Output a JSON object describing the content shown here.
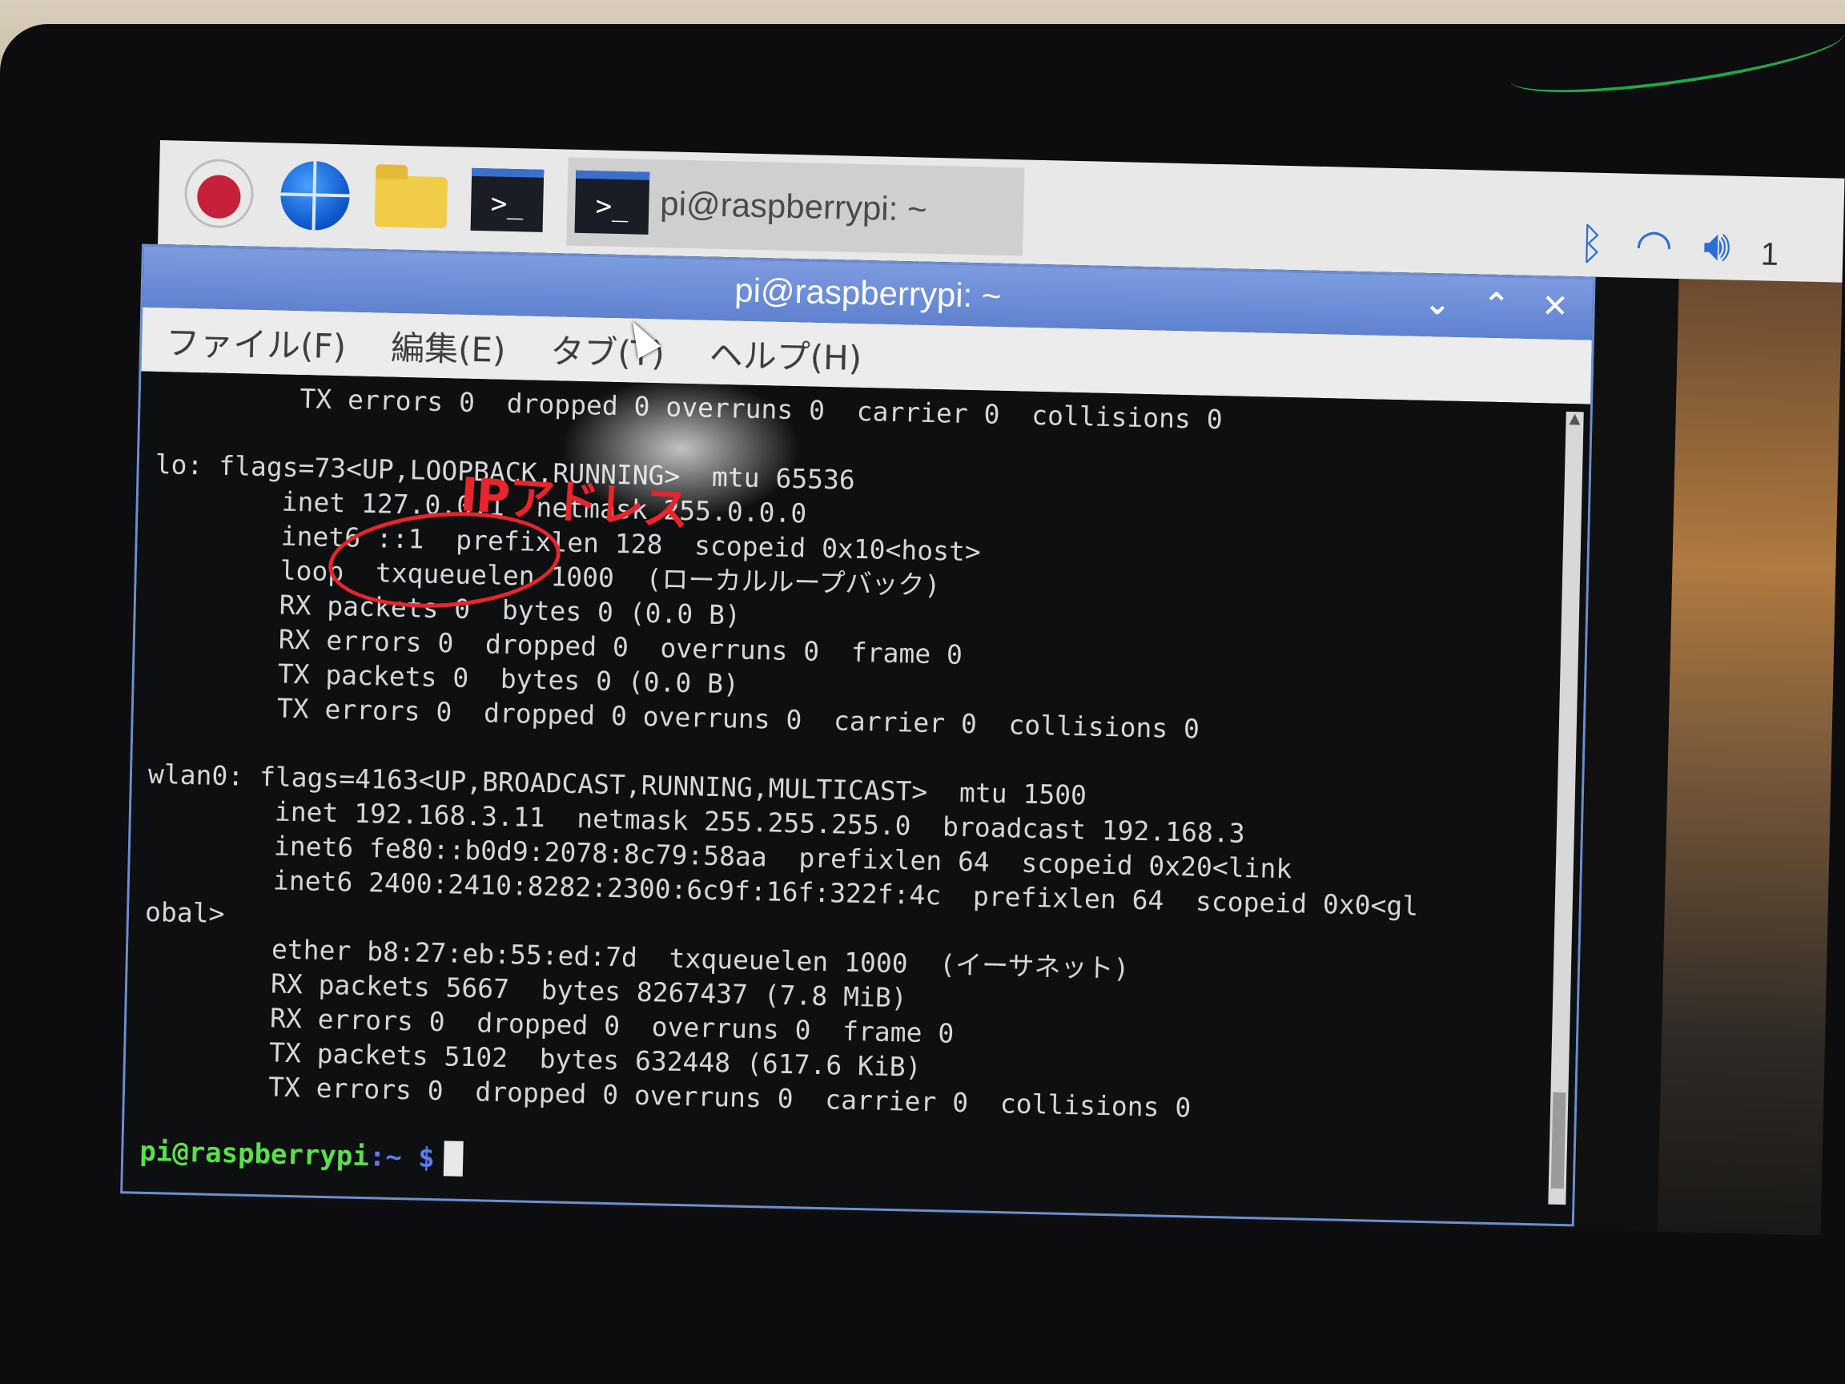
{
  "taskbar": {
    "task_title": "pi@raspberrypi: ~",
    "term_glyph": ">_",
    "clock": "1"
  },
  "window": {
    "title": "pi@raspberrypi: ~",
    "buttons": [
      "⌄",
      "⌃",
      "✕"
    ],
    "menu": [
      "ファイル(F)",
      "編集(E)",
      "タブ(T)",
      "ヘルプ(H)"
    ]
  },
  "terminal": {
    "lines": [
      "         TX errors 0  dropped 0 overruns 0  carrier 0  collisions 0",
      "",
      "lo: flags=73<UP,LOOPBACK,RUNNING>  mtu 65536",
      "        inet 127.0.0.1  netmask 255.0.0.0",
      "        inet6 ::1  prefixlen 128  scopeid 0x10<host>",
      "        loop  txqueuelen 1000  (ローカルループバック)",
      "        RX packets 0  bytes 0 (0.0 B)",
      "        RX errors 0  dropped 0  overruns 0  frame 0",
      "        TX packets 0  bytes 0 (0.0 B)",
      "        TX errors 0  dropped 0 overruns 0  carrier 0  collisions 0",
      "",
      "wlan0: flags=4163<UP,BROADCAST,RUNNING,MULTICAST>  mtu 1500",
      "        inet 192.168.3.11  netmask 255.255.255.0  broadcast 192.168.3",
      "        inet6 fe80::b0d9:2078:8c79:58aa  prefixlen 64  scopeid 0x20<link",
      "        inet6 2400:2410:8282:2300:6c9f:16f:322f:4c  prefixlen 64  scopeid 0x0<gl",
      "obal>",
      "        ether b8:27:eb:55:ed:7d  txqueuelen 1000  (イーサネット)",
      "        RX packets 5667  bytes 8267437 (7.8 MiB)",
      "        RX errors 0  dropped 0  overruns 0  frame 0",
      "        TX packets 5102  bytes 632448 (617.6 KiB)",
      "        TX errors 0  dropped 0 overruns 0  carrier 0  collisions 0"
    ],
    "prompt_user": "pi@raspberrypi",
    "prompt_path": ":~ $"
  },
  "annotation": {
    "text": "IPアドレス"
  },
  "colors": {
    "prompt_user": "#5ae04a",
    "prompt_path": "#5c7cf0",
    "annotation": "#e8242c",
    "titlebar": "#6d8ed0"
  },
  "icons": [
    "raspberry-menu-icon",
    "web-browser-icon",
    "file-manager-icon",
    "terminal-icon",
    "bluetooth-icon",
    "wifi-icon",
    "volume-icon"
  ]
}
